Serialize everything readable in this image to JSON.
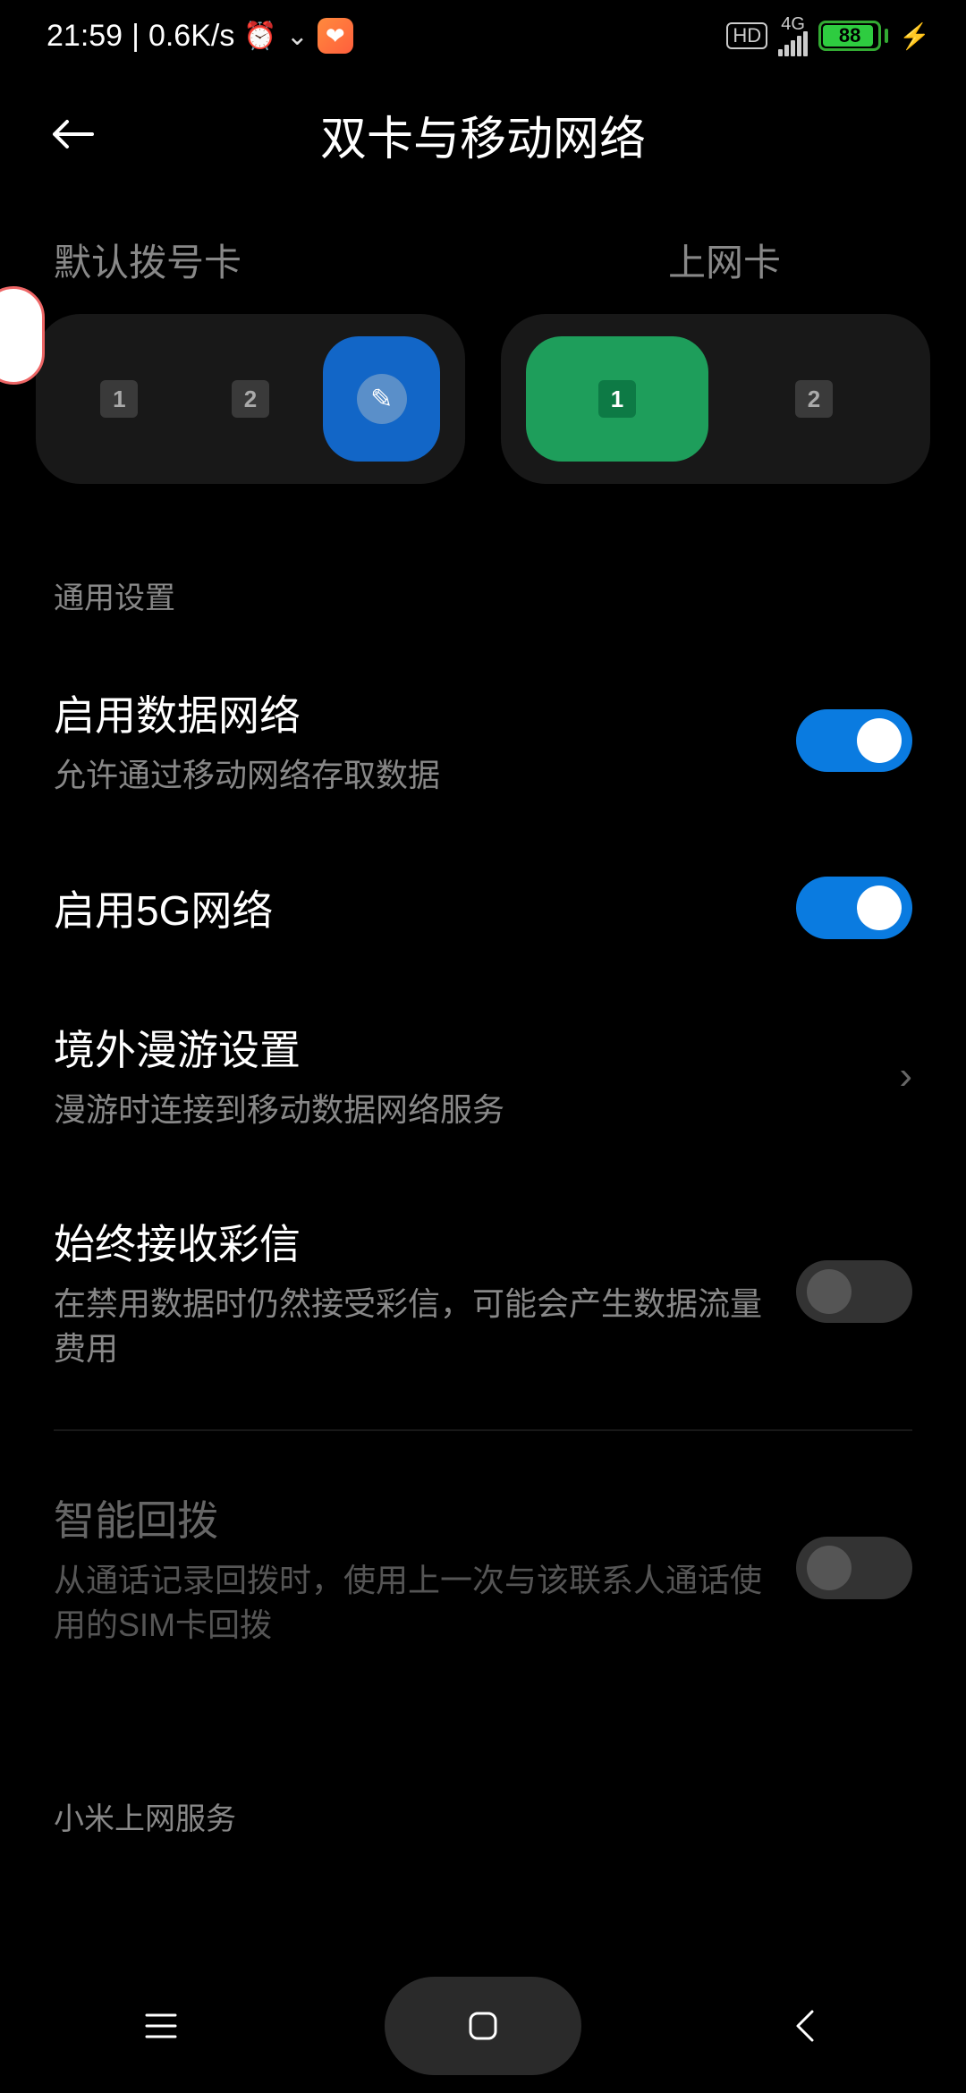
{
  "status": {
    "time": "21:59",
    "speed": "0.6K/s",
    "hd": "HD",
    "net": "4G",
    "battery": "88"
  },
  "header": {
    "title": "双卡与移动网络"
  },
  "sim": {
    "call_label": "默认拨号卡",
    "data_label": "上网卡",
    "opt1": "1",
    "opt2": "2"
  },
  "sections": {
    "general": "通用设置",
    "xiaomi_service": "小米上网服务"
  },
  "settings": {
    "mobile_data": {
      "title": "启用数据网络",
      "desc": "允许通过移动网络存取数据",
      "on": true
    },
    "enable_5g": {
      "title": "启用5G网络",
      "on": true
    },
    "roaming": {
      "title": "境外漫游设置",
      "desc": "漫游时连接到移动数据网络服务"
    },
    "mms": {
      "title": "始终接收彩信",
      "desc": "在禁用数据时仍然接受彩信，可能会产生数据流量费用",
      "on": false
    },
    "smart_callback": {
      "title": "智能回拨",
      "desc": "从通话记录回拨时，使用上一次与该联系人通话使用的SIM卡回拨",
      "on": false
    }
  }
}
